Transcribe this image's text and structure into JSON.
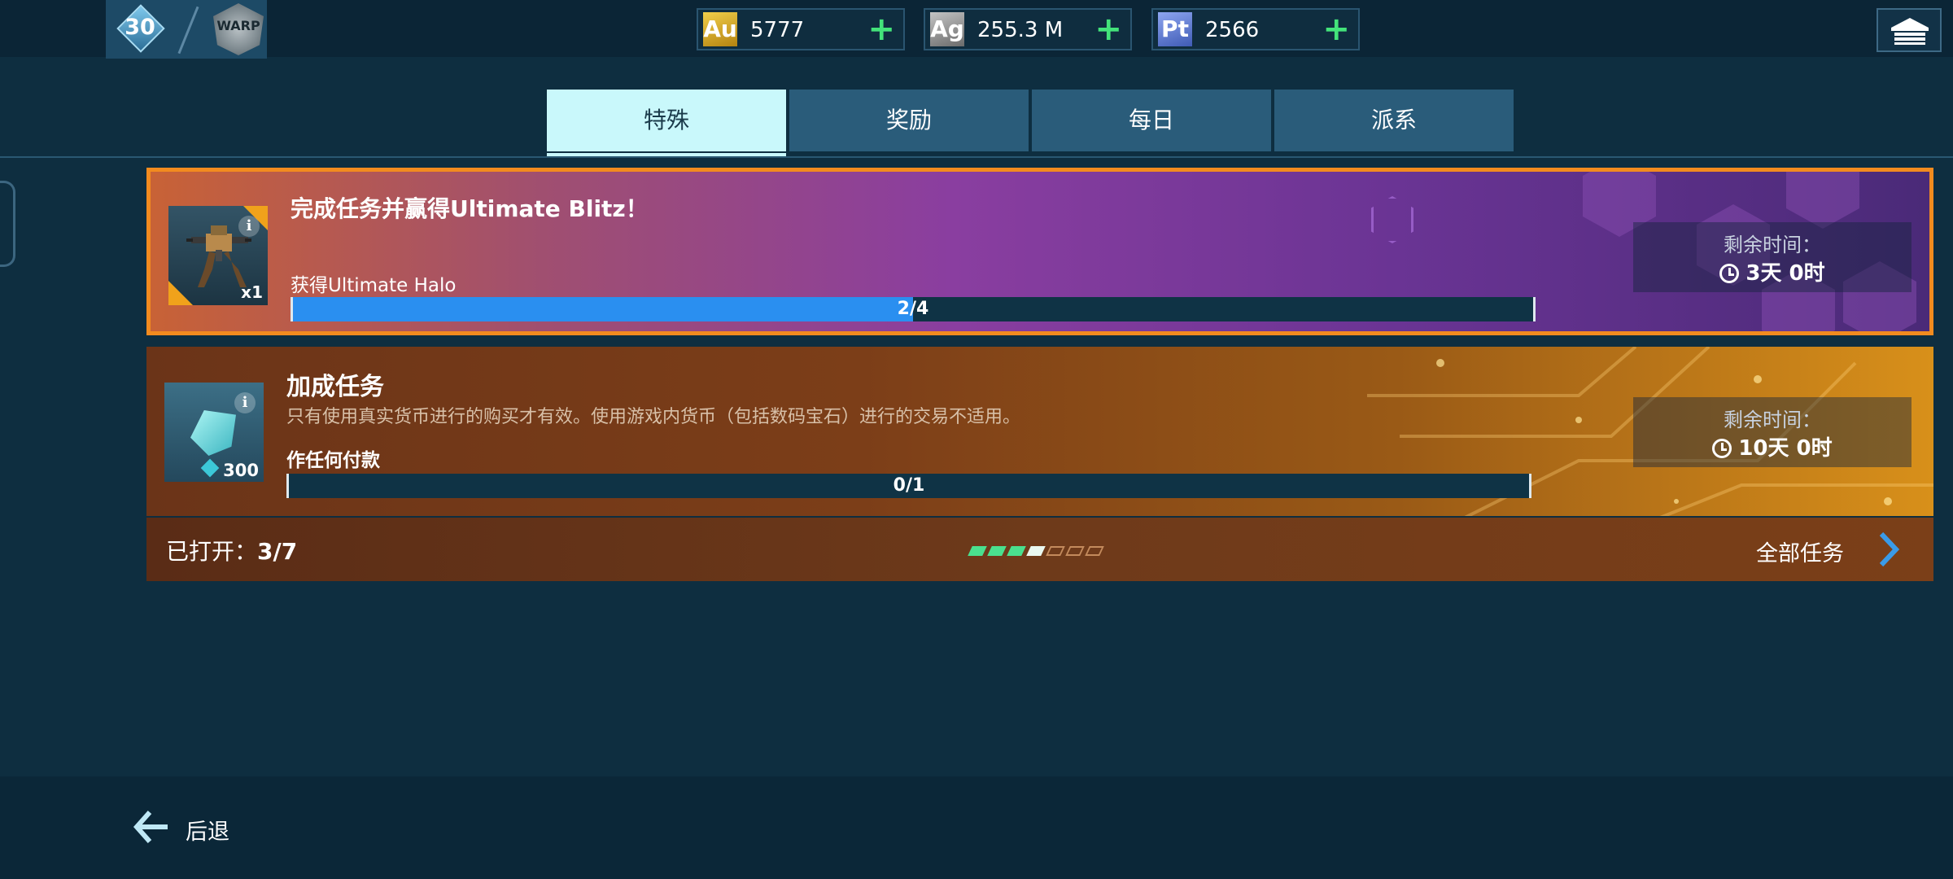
{
  "header": {
    "level": "30",
    "league_badge_text": "WARP",
    "currencies": [
      {
        "symbol": "Au",
        "value": "5777"
      },
      {
        "symbol": "Ag",
        "value": "255.3 M"
      },
      {
        "symbol": "Pt",
        "value": "2566"
      }
    ],
    "plus_label": "+"
  },
  "tabs": [
    {
      "label": "特殊",
      "active": true
    },
    {
      "label": "奖励",
      "active": false
    },
    {
      "label": "每日",
      "active": false
    },
    {
      "label": "派系",
      "active": false
    }
  ],
  "tasks": [
    {
      "title": "完成任务并赢得Ultimate Blitz！",
      "subtitle": "获得Ultimate Halo",
      "reward_qty": "x1",
      "progress_text": "2/4",
      "progress_fraction": 0.5,
      "timer_label": "剩余时间：",
      "timer_value": "3天 0时"
    },
    {
      "title": "加成任务",
      "description": "只有使用真实货币进行的购买才有效。使用游戏内货币（包括数码宝石）进行的交易不适用。",
      "subtitle": "作任何付款",
      "reward_qty": "300",
      "progress_text": "0/1",
      "progress_fraction": 0,
      "timer_label": "剩余时间：",
      "timer_value": "10天 0时"
    }
  ],
  "footer": {
    "opened_label": "已打开：",
    "opened_count": "3/7",
    "page_dots": {
      "total": 7,
      "filled": 3,
      "current": 4
    },
    "all_tasks_label": "全部任务"
  },
  "bottom": {
    "back_label": "后退"
  },
  "colors": {
    "accent_green": "#43e37a",
    "card_border": "#f28b1f",
    "progress_blue": "#2a8ff0",
    "tab_active": "#c9f8fb",
    "tab_inactive": "#2a5c7a"
  }
}
